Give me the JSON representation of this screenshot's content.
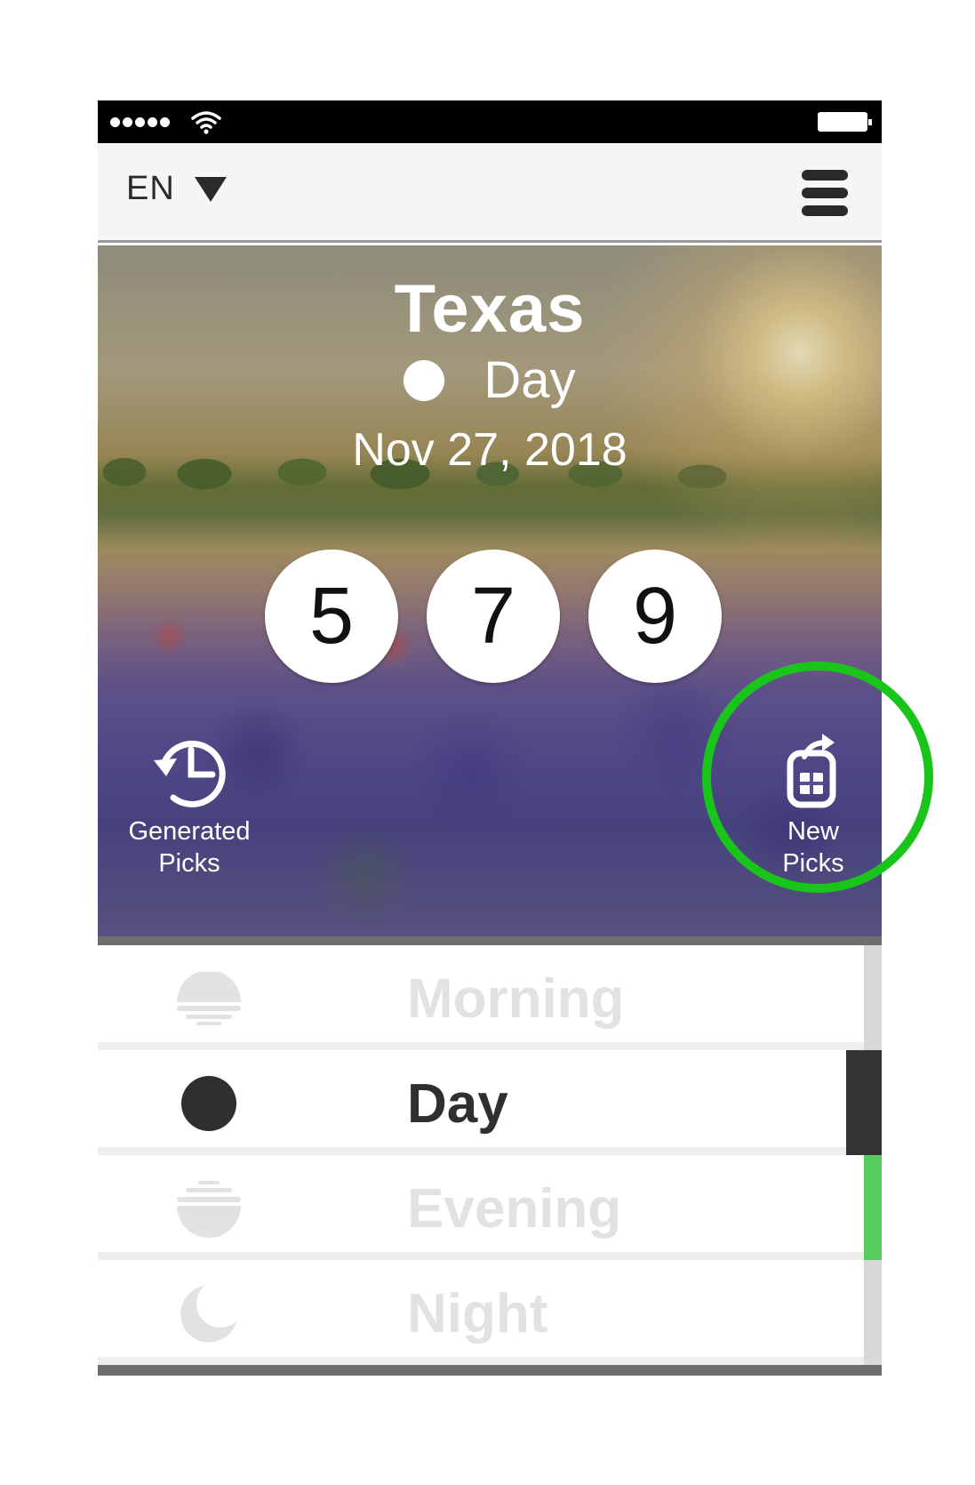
{
  "header": {
    "language": "EN",
    "menu_icon": "hamburger-menu-icon"
  },
  "hero": {
    "state": "Texas",
    "draw_time": "Day",
    "date": "Nov 27, 2018",
    "numbers": [
      "5",
      "7",
      "9"
    ],
    "generated_picks_label": "Generated Picks",
    "new_picks_label": "New Picks"
  },
  "draw_times": {
    "items": [
      {
        "label": "Morning",
        "icon": "sunrise-icon",
        "active": false,
        "indicator": "gray"
      },
      {
        "label": "Day",
        "icon": "sun-dot-icon",
        "active": true,
        "indicator": "dark"
      },
      {
        "label": "Evening",
        "icon": "sunset-icon",
        "active": false,
        "indicator": "green"
      },
      {
        "label": "Night",
        "icon": "moon-icon",
        "active": false,
        "indicator": "gray"
      }
    ]
  },
  "colors": {
    "highlight": "#19c41b",
    "active_indicator": "#333333",
    "evening_indicator": "#59cc5e",
    "inactive_text": "#e2e2e2"
  }
}
